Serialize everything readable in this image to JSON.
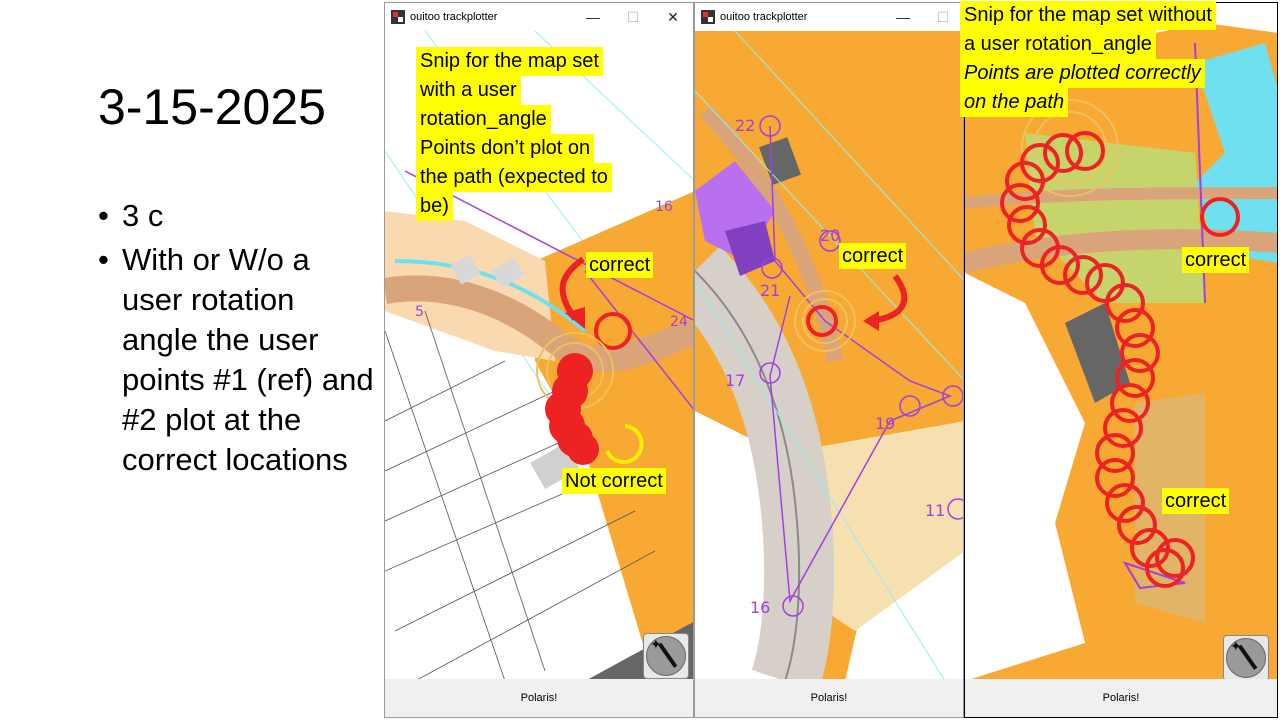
{
  "slide": {
    "title": "3-15-2025",
    "bullets": [
      "3 c",
      "With or W/o a user rotation angle the user points #1 (ref) and #2 plot at the correct locations"
    ]
  },
  "windows": [
    {
      "title": "ouitoo trackplotter",
      "controls": [
        "—",
        "☐",
        "✕"
      ],
      "footer_button": "Polaris!"
    },
    {
      "title": "ouitoo trackplotter",
      "controls": [
        "—",
        "☐"
      ],
      "footer_button": "Polaris!"
    },
    {
      "footer_button": "Polaris!"
    }
  ],
  "annotations": {
    "panel1_note": [
      "Snip for the map set",
      "with a user",
      "rotation_angle",
      "Points don’t plot on",
      "the path (expected to",
      "be)"
    ],
    "panel1_correct": "correct",
    "panel1_not_correct": "Not correct",
    "panel2_correct": "correct",
    "panel3_note": [
      "Snip for the map set without",
      "a user rotation_angle"
    ],
    "panel3_note_italic": [
      "Points are plotted correctly",
      "on the path"
    ],
    "panel3_correct_top": "correct",
    "panel3_correct_bottom": "correct"
  },
  "map_labels": {
    "panel1": [
      "5",
      "24",
      "16"
    ],
    "panel2": [
      "22",
      "20",
      "21",
      "17",
      "19",
      "11",
      "16"
    ]
  },
  "colors": {
    "map_orange": "#f7a934",
    "map_path": "#d9a47a",
    "map_blue": "#6ee0f0",
    "map_purple": "#a040e0",
    "map_green": "#b8e07a",
    "track_red": "#ee2222",
    "highlight": "#ffff00"
  },
  "icons": [
    "app-icon",
    "magic-wand-icon",
    "minimize-icon",
    "maximize-icon",
    "close-icon"
  ]
}
